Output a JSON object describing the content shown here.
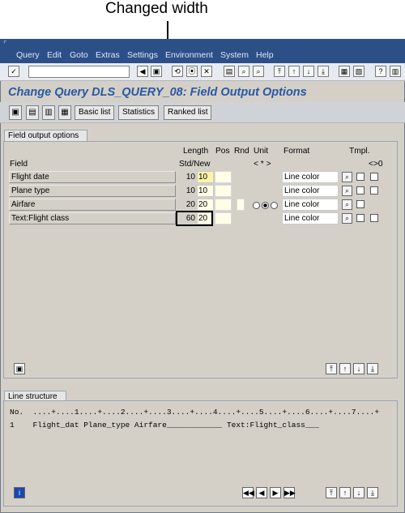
{
  "callout": {
    "text": "Changed width"
  },
  "menu": {
    "items": [
      "Query",
      "Edit",
      "Goto",
      "Extras",
      "Settings",
      "Environment",
      "System",
      "Help"
    ]
  },
  "window": {
    "title": "Change Query DLS_QUERY_08: Field Output Options"
  },
  "toolbar": {
    "basic_list": "Basic list",
    "statistics": "Statistics",
    "ranked_list": "Ranked list"
  },
  "field_output": {
    "tab": "Field output options",
    "headers": {
      "field": "Field",
      "length": "Length",
      "std_new": "Std/New",
      "pos": "Pos",
      "rnd": "Rnd",
      "unit": "Unit",
      "unit_symbols": "< * >",
      "format": "Format",
      "tmpl": "Tmpl.",
      "tmpl_symbols": "<>0"
    },
    "rows": [
      {
        "field": "Flight date",
        "std": "10",
        "new": "10",
        "format": "Line color"
      },
      {
        "field": "Plane type",
        "std": "10",
        "new": "10",
        "format": "Line color"
      },
      {
        "field": "Airfare",
        "std": "20",
        "new": "20",
        "format": "Line color"
      },
      {
        "field": "Text:Flight class",
        "std": "60",
        "new": "20",
        "format": "Line color"
      }
    ]
  },
  "line_structure": {
    "tab": "Line structure",
    "ruler": "No.  ....+....1....+....2....+....3....+....4....+....5....+....6....+....7....+",
    "row": "1    Flight_dat Plane_type Airfare____________ Text:Flight_class___"
  }
}
